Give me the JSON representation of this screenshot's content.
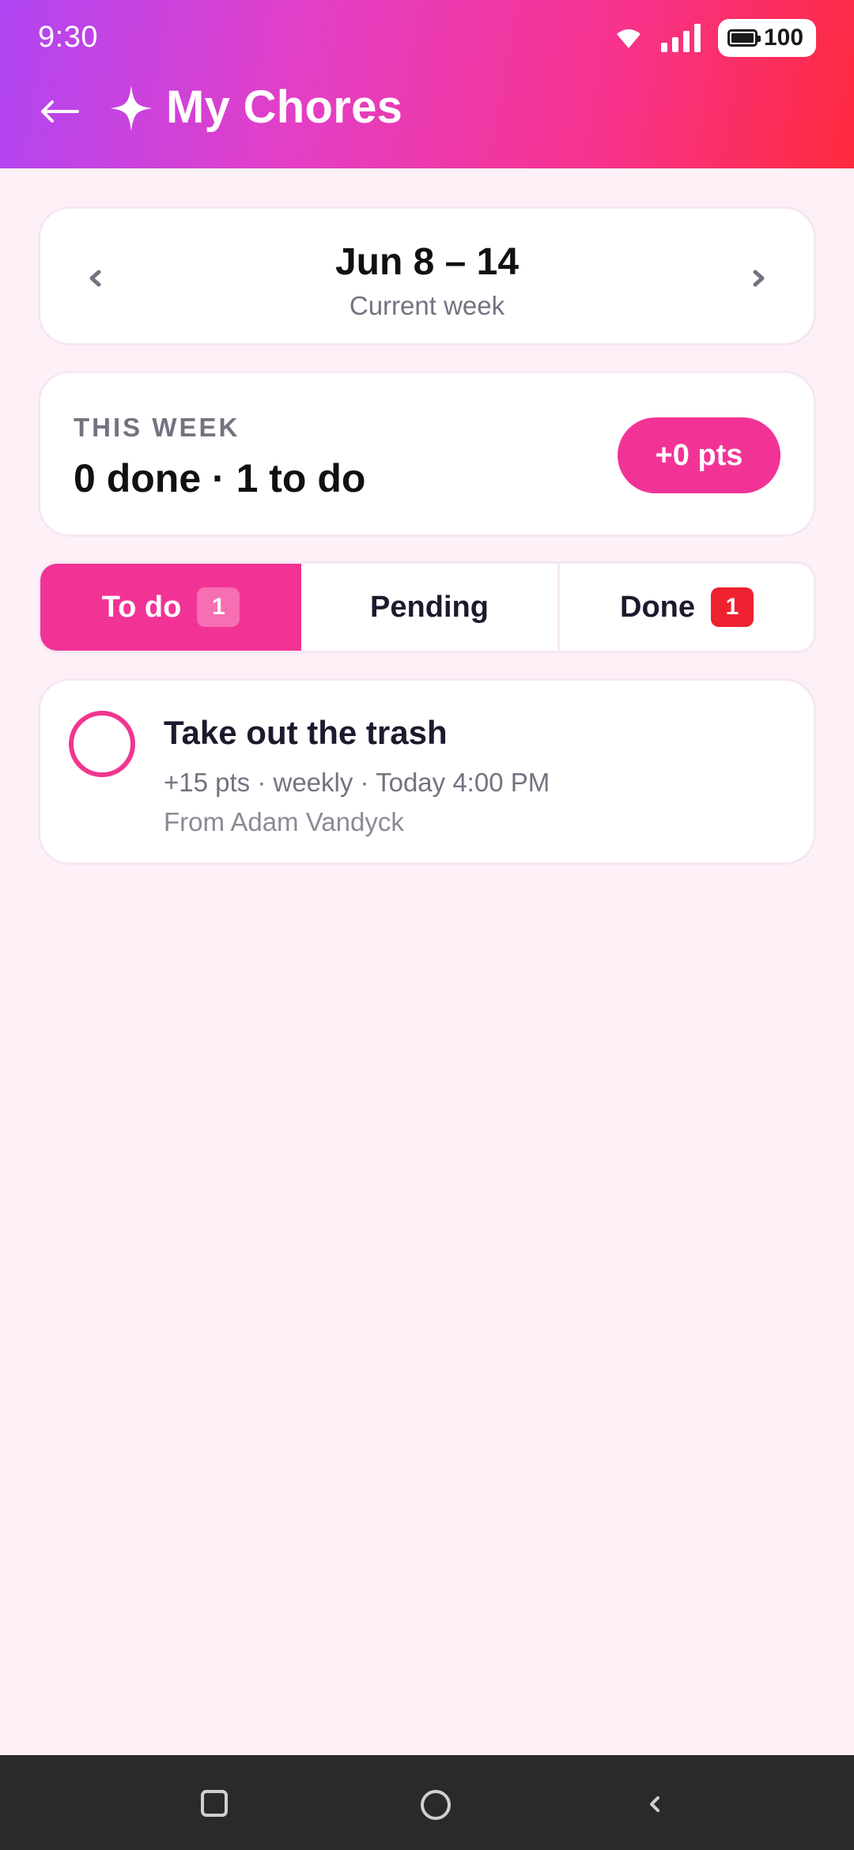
{
  "status_bar": {
    "time": "9:30",
    "battery": "100",
    "icons": [
      "wifi-icon",
      "signal-icon",
      "battery-icon"
    ]
  },
  "app_bar": {
    "back_icon": "back-arrow-icon",
    "title_icon": "sparkle-icon",
    "title": "My Chores"
  },
  "week": {
    "range": "Jun 8 – 14",
    "subtitle": "Current week",
    "prev_icon": "chevron-left-icon",
    "next_icon": "chevron-right-icon"
  },
  "summary": {
    "label": "THIS WEEK",
    "value": "0 done · 1 to do",
    "points": "+0 pts"
  },
  "tabs": [
    {
      "label": "To do",
      "badge": "1",
      "active": true
    },
    {
      "label": "Pending",
      "badge": "",
      "active": false
    },
    {
      "label": "Done",
      "badge": "1",
      "active": false
    }
  ],
  "chores": [
    {
      "title": "Take out the trash",
      "meta": "+15 pts · weekly · Today 4:00 PM",
      "from": "From Adam Vandyck",
      "done": false
    }
  ],
  "colors": {
    "accent": "#f23396",
    "badge_red": "#ee2230",
    "background": "#fdf1f7",
    "header_gradient": [
      "#b046f3",
      "#f7338f",
      "#fe2a3e"
    ]
  }
}
